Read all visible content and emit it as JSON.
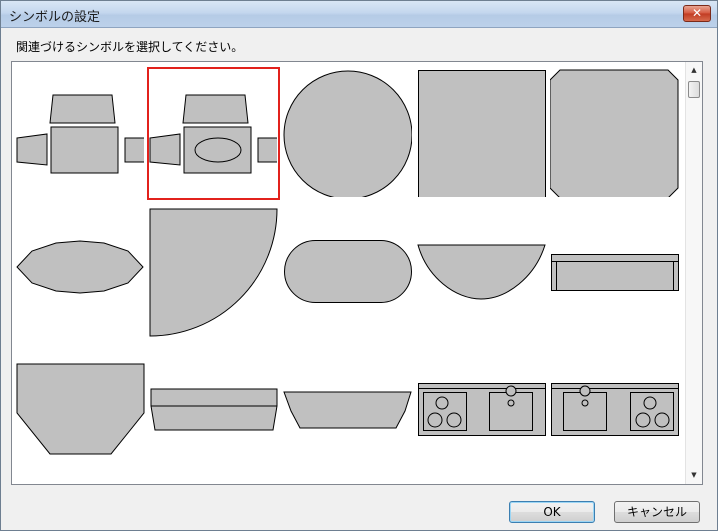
{
  "window": {
    "title": "シンボルの設定",
    "close_label": "✕"
  },
  "instruction": "関連づけるシンボルを選択してください。",
  "scrollbar": {
    "up_arrow": "▲",
    "down_arrow": "▼"
  },
  "symbols": [
    {
      "name": "symbol-desk-chairs"
    },
    {
      "name": "symbol-desk-chairs-oval",
      "selected": true
    },
    {
      "name": "symbol-circle-table"
    },
    {
      "name": "symbol-square-table"
    },
    {
      "name": "symbol-octagon-table"
    },
    {
      "name": "symbol-oval-table"
    },
    {
      "name": "symbol-quarter-circle"
    },
    {
      "name": "symbol-rounded-table"
    },
    {
      "name": "symbol-half-circle"
    },
    {
      "name": "symbol-counter-shelf"
    },
    {
      "name": "symbol-bay-counter"
    },
    {
      "name": "symbol-trapezoid-counter"
    },
    {
      "name": "symbol-angled-counter"
    },
    {
      "name": "symbol-stove-left-sink"
    },
    {
      "name": "symbol-sink-right-stove"
    }
  ],
  "buttons": {
    "ok": "OK",
    "cancel": "キャンセル"
  },
  "colors": {
    "shape_fill": "#c0c0c0",
    "shape_stroke": "#000000",
    "selection": "#e2211c"
  }
}
